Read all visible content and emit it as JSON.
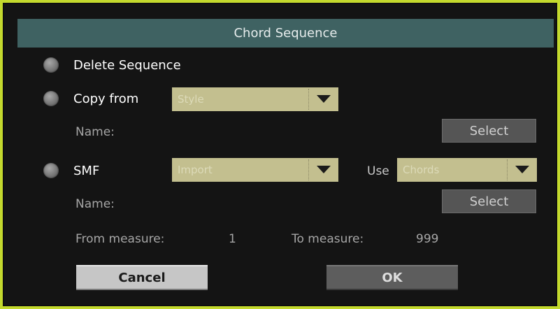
{
  "dialog": {
    "title": "Chord Sequence",
    "delete_label": "Delete Sequence",
    "copy_from": {
      "label": "Copy from",
      "dropdown_value": "Style",
      "name_label": "Name:",
      "select_label": "Select"
    },
    "smf": {
      "label": "SMF",
      "dropdown_value": "Import",
      "use_label": "Use",
      "use_value": "Chords",
      "name_label": "Name:",
      "select_label": "Select"
    },
    "from_measure_label": "From measure:",
    "from_measure_value": "1",
    "to_measure_label": "To measure:",
    "to_measure_value": "999",
    "cancel_label": "Cancel",
    "ok_label": "OK"
  },
  "colors": {
    "frame": "#c4d92e",
    "background": "#141414",
    "title_bar": "#3f6262",
    "dropdown": "#c3bf8f",
    "select_button": "#555555",
    "cancel_button": "#c6c6c6",
    "ok_button": "#5d5d5d"
  },
  "icons": {
    "dropdown_arrow": "triangle-down-icon",
    "radio": "radio-button-icon"
  }
}
